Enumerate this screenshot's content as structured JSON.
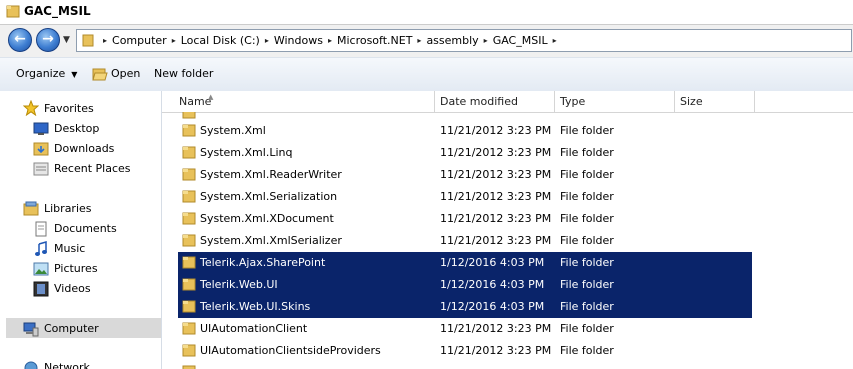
{
  "window": {
    "title": "GAC_MSIL"
  },
  "address": {
    "crumbs": [
      "Computer",
      "Local Disk (C:)",
      "Windows",
      "Microsoft.NET",
      "assembly",
      "GAC_MSIL"
    ]
  },
  "toolbar": {
    "organize": "Organize",
    "open": "Open",
    "new_folder": "New folder"
  },
  "nav": {
    "favorites": "Favorites",
    "desktop": "Desktop",
    "downloads": "Downloads",
    "recent_places": "Recent Places",
    "libraries": "Libraries",
    "documents": "Documents",
    "music": "Music",
    "pictures": "Pictures",
    "videos": "Videos",
    "computer": "Computer",
    "network": "Network"
  },
  "columns": {
    "name": "Name",
    "date": "Date modified",
    "type": "Type",
    "size": "Size"
  },
  "rows": [
    {
      "name": "System.Xml",
      "date": "11/21/2012 3:23 PM",
      "type": "File folder"
    },
    {
      "name": "System.Xml.Linq",
      "date": "11/21/2012 3:23 PM",
      "type": "File folder"
    },
    {
      "name": "System.Xml.ReaderWriter",
      "date": "11/21/2012 3:23 PM",
      "type": "File folder"
    },
    {
      "name": "System.Xml.Serialization",
      "date": "11/21/2012 3:23 PM",
      "type": "File folder"
    },
    {
      "name": "System.Xml.XDocument",
      "date": "11/21/2012 3:23 PM",
      "type": "File folder"
    },
    {
      "name": "System.Xml.XmlSerializer",
      "date": "11/21/2012 3:23 PM",
      "type": "File folder"
    },
    {
      "name": "Telerik.Ajax.SharePoint",
      "date": "1/12/2016 4:03 PM",
      "type": "File folder"
    },
    {
      "name": "Telerik.Web.UI",
      "date": "1/12/2016 4:03 PM",
      "type": "File folder"
    },
    {
      "name": "Telerik.Web.UI.Skins",
      "date": "1/12/2016 4:03 PM",
      "type": "File folder"
    },
    {
      "name": "UIAutomationClient",
      "date": "11/21/2012 3:23 PM",
      "type": "File folder"
    },
    {
      "name": "UIAutomationClientsideProviders",
      "date": "11/21/2012 3:23 PM",
      "type": "File folder"
    }
  ],
  "colors": {
    "selection": "#0a246a",
    "folder": "#e8c15a"
  }
}
